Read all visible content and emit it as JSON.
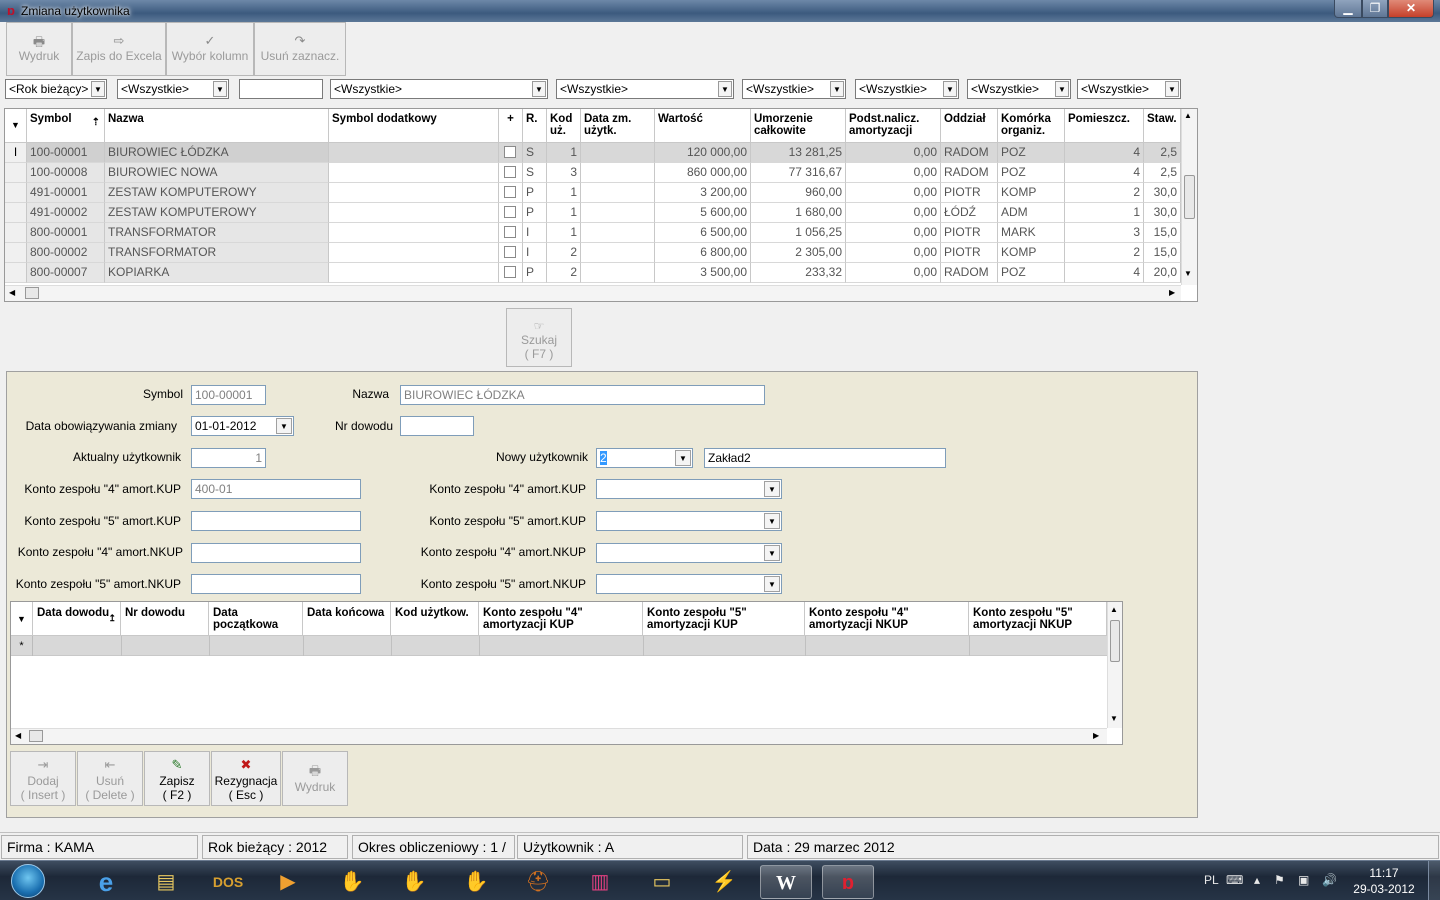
{
  "window": {
    "title": "Zmiana użytkownika",
    "min": "▁",
    "max": "❐",
    "close": "✕"
  },
  "toolbar": [
    {
      "label": "Wydruk",
      "icon": "printer-icon",
      "glyph": "🖶"
    },
    {
      "label": "Zapis do Excela",
      "icon": "export-excel-icon",
      "glyph": "⇨"
    },
    {
      "label": "Wybór kolumn",
      "icon": "checkmark-icon",
      "glyph": "✓"
    },
    {
      "label": "Usuń zaznacz.",
      "icon": "eraser-icon",
      "glyph": "↷"
    }
  ],
  "filters": [
    "<Rok bieżący>",
    "<Wszystkie>",
    "",
    "<Wszystkie>",
    "<Wszystkie>",
    "<Wszystkie>",
    "<Wszystkie>",
    "<Wszystkie>",
    "<Wszystkie>"
  ],
  "grid1": {
    "headers": [
      "Symbol",
      "Nazwa",
      "Symbol dodatkowy",
      "+",
      "R.",
      "Kod uż.",
      "Data zm. użytk.",
      "Wartość",
      "Umorzenie całkowite",
      "Podst.nalicz. amortyzacji",
      "Oddział",
      "Komórka organiz.",
      "Pomieszcz.",
      "Staw."
    ],
    "rows": [
      [
        "100-00001",
        "BIUROWIEC ŁÓDZKA",
        "",
        "",
        "S",
        "1",
        "",
        "120 000,00",
        "13 281,25",
        "0,00",
        "RADOM",
        "POZ",
        "4",
        "2,5"
      ],
      [
        "100-00008",
        "BIUROWIEC NOWA",
        "",
        "",
        "S",
        "3",
        "",
        "860 000,00",
        "77 316,67",
        "0,00",
        "RADOM",
        "POZ",
        "4",
        "2,5"
      ],
      [
        "491-00001",
        "ZESTAW KOMPUTEROWY",
        "",
        "",
        "P",
        "1",
        "",
        "3 200,00",
        "960,00",
        "0,00",
        "PIOTR",
        "KOMP",
        "2",
        "30,0"
      ],
      [
        "491-00002",
        "ZESTAW KOMPUTEROWY",
        "",
        "",
        "P",
        "1",
        "",
        "5 600,00",
        "1 680,00",
        "0,00",
        "ŁÓDŹ",
        "ADM",
        "1",
        "30,0"
      ],
      [
        "800-00001",
        "TRANSFORMATOR",
        "",
        "",
        "I",
        "1",
        "",
        "6 500,00",
        "1 056,25",
        "0,00",
        "PIOTR",
        "MARK",
        "3",
        "15,0"
      ],
      [
        "800-00002",
        "TRANSFORMATOR",
        "",
        "",
        "I",
        "2",
        "",
        "6 800,00",
        "2 305,00",
        "0,00",
        "PIOTR",
        "KOMP",
        "2",
        "15,0"
      ],
      [
        "800-00007",
        "KOPIARKA",
        "",
        "",
        "P",
        "2",
        "",
        "3 500,00",
        "233,32",
        "0,00",
        "RADOM",
        "POZ",
        "4",
        "20,0"
      ]
    ]
  },
  "search": {
    "label": "Szukaj",
    "key": "( F7 )"
  },
  "form": {
    "symbol_label": "Symbol",
    "symbol_value": "100-00001",
    "nazwa_label": "Nazwa",
    "nazwa_value": "BIUROWIEC ŁÓDZKA",
    "data_label": "Data obowiązywania zmiany",
    "data_value": "01-01-2012",
    "nrdowodu_label": "Nr dowodu",
    "nrdowodu_value": "",
    "aktualny_label": "Aktualny użytkownik",
    "aktualny_value": "1",
    "nowy_label": "Nowy użytkownik",
    "nowy_value": "2",
    "nowy_name": "Zakład2",
    "left": [
      {
        "label": "Konto zespołu \"4\" amort.KUP",
        "value": "400-01"
      },
      {
        "label": "Konto zespołu \"5\" amort.KUP",
        "value": ""
      },
      {
        "label": "Konto zespołu \"4\" amort.NKUP",
        "value": ""
      },
      {
        "label": "Konto zespołu \"5\" amort.NKUP",
        "value": ""
      }
    ],
    "right": [
      {
        "label": "Konto zespołu \"4\" amort.KUP",
        "value": ""
      },
      {
        "label": "Konto zespołu \"5\" amort.KUP",
        "value": ""
      },
      {
        "label": "Konto zespołu \"4\" amort.NKUP",
        "value": ""
      },
      {
        "label": "Konto zespołu \"5\" amort.NKUP",
        "value": ""
      }
    ]
  },
  "grid2": {
    "headers": [
      "Data dowodu",
      "Nr dowodu",
      "Data początkowa",
      "Data końcowa",
      "Kod użytkow.",
      "Konto zespołu \"4\" amortyzacji KUP",
      "Konto zespołu \"5\" amortyzacji KUP",
      "Konto zespołu \"4\" amortyzacji NKUP",
      "Konto zespołu \"5\" amortyzacji NKUP"
    ],
    "new_row_marker": "*"
  },
  "actions": [
    {
      "label": "Dodaj",
      "key": "( Insert )",
      "glyph": "⇥",
      "active": false
    },
    {
      "label": "Usuń",
      "key": "( Delete )",
      "glyph": "⇤",
      "active": false
    },
    {
      "label": "Zapisz",
      "key": "( F2 )",
      "glyph": "✎",
      "active": true
    },
    {
      "label": "Rezygnacja",
      "key": "( Esc )",
      "glyph": "✖",
      "active": true
    },
    {
      "label": "Wydruk",
      "key": "",
      "glyph": "🖶",
      "active": false
    }
  ],
  "status": {
    "firma": "Firma : KAMA",
    "rok": "Rok bieżący : 2012",
    "okres": "Okres obliczeniowy : 1 /",
    "uzytkownik": "Użytkownik : A",
    "data": "Data : 29 marzec 2012"
  },
  "taskbar": {
    "lang": "PL",
    "time": "11:17",
    "date": "29-03-2012"
  }
}
